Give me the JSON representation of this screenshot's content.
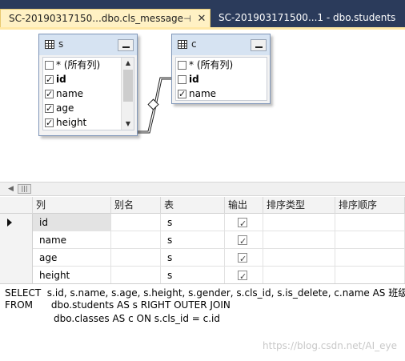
{
  "tabs": [
    {
      "label": "SC-20190317150...dbo.cls_message",
      "active": true
    },
    {
      "label": "SC-201903171500...1 - dbo.students",
      "active": false
    }
  ],
  "tab_icons": {
    "pin": "pin-icon",
    "close": "close-icon"
  },
  "diagram": {
    "table_s": {
      "alias": "s",
      "columns": [
        {
          "label": "* (所有列)",
          "checked": false,
          "bold": false
        },
        {
          "label": "id",
          "checked": true,
          "bold": true
        },
        {
          "label": "name",
          "checked": true,
          "bold": false
        },
        {
          "label": "age",
          "checked": true,
          "bold": false
        },
        {
          "label": "height",
          "checked": true,
          "bold": false
        }
      ]
    },
    "table_c": {
      "alias": "c",
      "columns": [
        {
          "label": "* (所有列)",
          "checked": false,
          "bold": false
        },
        {
          "label": "id",
          "checked": false,
          "bold": true
        },
        {
          "label": "name",
          "checked": true,
          "bold": false
        }
      ]
    }
  },
  "grid": {
    "headers": [
      "列",
      "别名",
      "表",
      "输出",
      "排序类型",
      "排序顺序"
    ],
    "rows": [
      {
        "column": "id",
        "alias": "",
        "table": "s",
        "output": true
      },
      {
        "column": "name",
        "alias": "",
        "table": "s",
        "output": true
      },
      {
        "column": "age",
        "alias": "",
        "table": "s",
        "output": true
      },
      {
        "column": "height",
        "alias": "",
        "table": "s",
        "output": true
      }
    ]
  },
  "sql": {
    "line1": "SELECT  s.id, s.name, s.age, s.height, s.gender, s.cls_id, s.is_delete, c.name AS 班级",
    "line2": "FROM      dbo.students AS s RIGHT OUTER JOIN",
    "line3": "                dbo.classes AS c ON s.cls_id = c.id"
  },
  "watermark": "https://blog.csdn.net/AI_eye",
  "colors": {
    "tab_bar": "#2b3b5b",
    "active_tab": "#fff1c4",
    "table_header": "#d6e3f2"
  }
}
